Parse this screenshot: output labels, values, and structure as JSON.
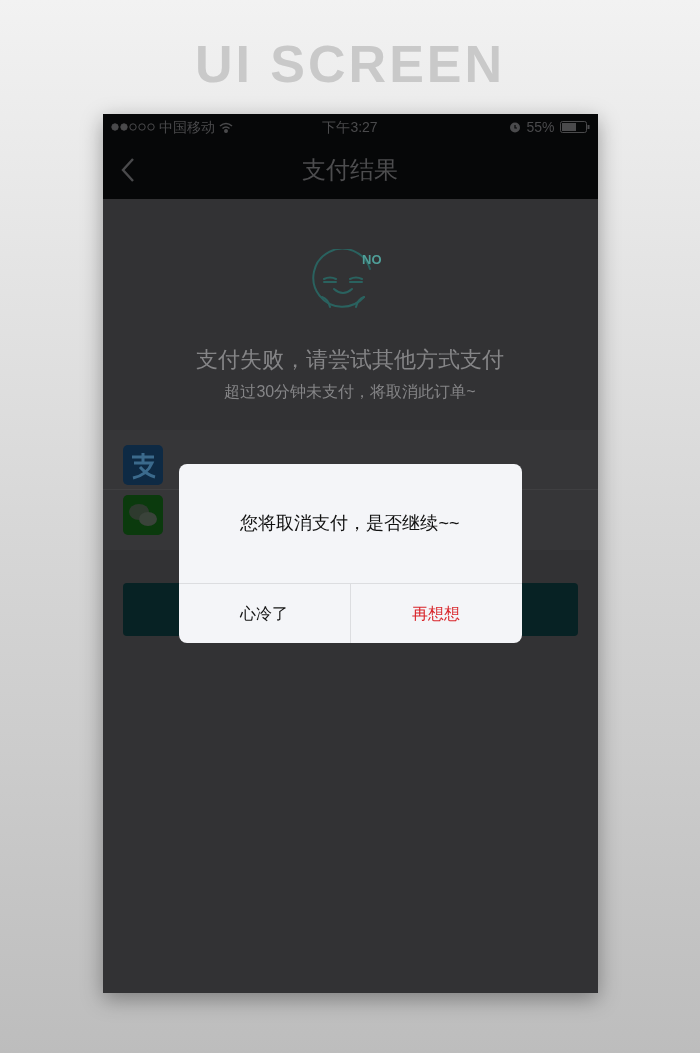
{
  "heading": "UI SCREEN",
  "status_bar": {
    "carrier": "中国移动",
    "time": "下午3:27",
    "battery": "55%"
  },
  "nav": {
    "title": "支付结果"
  },
  "result": {
    "icon_badge": "NO",
    "title": "支付失败，请尝试其他方式支付",
    "subtitle": "超过30分钟未支付，将取消此订单~"
  },
  "payment_methods": [
    {
      "kind": "alipay"
    },
    {
      "kind": "wechat"
    }
  ],
  "dialog": {
    "message": "您将取消支付，是否继续~~",
    "buttons": [
      {
        "label": "心冷了",
        "kind": "cancel"
      },
      {
        "label": "再想想",
        "kind": "primary"
      }
    ]
  }
}
